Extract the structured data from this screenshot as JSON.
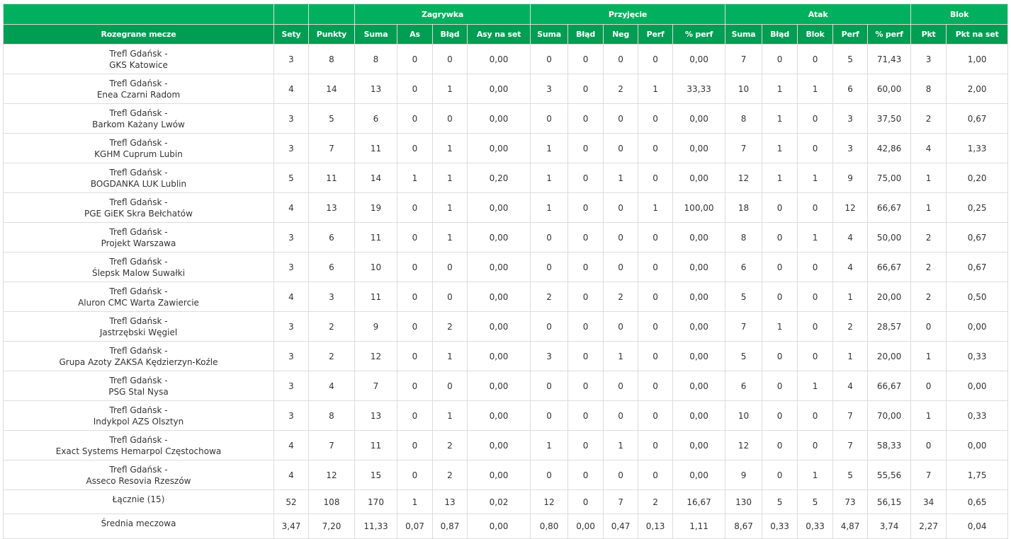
{
  "group_headers": [
    "Zagrywka",
    "Przyjęcie",
    "Atak",
    "Blok"
  ],
  "columns": [
    "Rozegrane mecze",
    "Sety",
    "Punkty",
    "Suma",
    "As",
    "Błąd",
    "Asy na set",
    "Suma",
    "Błąd",
    "Neg",
    "Perf",
    "% perf",
    "Suma",
    "Błąd",
    "Blok",
    "Perf",
    "% perf",
    "Pkt",
    "Pkt na set"
  ],
  "rows": [
    {
      "home": "Trefl Gdańsk -",
      "away": "GKS Katowice",
      "values": [
        "3",
        "8",
        "8",
        "0",
        "0",
        "0,00",
        "0",
        "0",
        "0",
        "0",
        "0,00",
        "7",
        "0",
        "0",
        "5",
        "71,43",
        "3",
        "1,00"
      ]
    },
    {
      "home": "Trefl Gdańsk -",
      "away": "Enea Czarni Radom",
      "values": [
        "4",
        "14",
        "13",
        "0",
        "1",
        "0,00",
        "3",
        "0",
        "2",
        "1",
        "33,33",
        "10",
        "1",
        "1",
        "6",
        "60,00",
        "8",
        "2,00"
      ]
    },
    {
      "home": "Trefl Gdańsk -",
      "away": "Barkom Każany Lwów",
      "values": [
        "3",
        "5",
        "6",
        "0",
        "0",
        "0,00",
        "0",
        "0",
        "0",
        "0",
        "0,00",
        "8",
        "1",
        "0",
        "3",
        "37,50",
        "2",
        "0,67"
      ]
    },
    {
      "home": "Trefl Gdańsk -",
      "away": "KGHM Cuprum Lubin",
      "values": [
        "3",
        "7",
        "11",
        "0",
        "1",
        "0,00",
        "1",
        "0",
        "0",
        "0",
        "0,00",
        "7",
        "1",
        "0",
        "3",
        "42,86",
        "4",
        "1,33"
      ]
    },
    {
      "home": "Trefl Gdańsk -",
      "away": "BOGDANKA LUK Lublin",
      "values": [
        "5",
        "11",
        "14",
        "1",
        "1",
        "0,20",
        "1",
        "0",
        "1",
        "0",
        "0,00",
        "12",
        "1",
        "1",
        "9",
        "75,00",
        "1",
        "0,20"
      ]
    },
    {
      "home": "Trefl Gdańsk -",
      "away": "PGE GiEK Skra Bełchatów",
      "values": [
        "4",
        "13",
        "19",
        "0",
        "1",
        "0,00",
        "1",
        "0",
        "0",
        "1",
        "100,00",
        "18",
        "0",
        "0",
        "12",
        "66,67",
        "1",
        "0,25"
      ]
    },
    {
      "home": "Trefl Gdańsk -",
      "away": "Projekt Warszawa",
      "values": [
        "3",
        "6",
        "11",
        "0",
        "1",
        "0,00",
        "0",
        "0",
        "0",
        "0",
        "0,00",
        "8",
        "0",
        "1",
        "4",
        "50,00",
        "2",
        "0,67"
      ]
    },
    {
      "home": "Trefl Gdańsk -",
      "away": "Ślepsk Malow Suwałki",
      "values": [
        "3",
        "6",
        "10",
        "0",
        "0",
        "0,00",
        "0",
        "0",
        "0",
        "0",
        "0,00",
        "6",
        "0",
        "0",
        "4",
        "66,67",
        "2",
        "0,67"
      ]
    },
    {
      "home": "Trefl Gdańsk -",
      "away": "Aluron CMC Warta Zawiercie",
      "values": [
        "4",
        "3",
        "11",
        "0",
        "0",
        "0,00",
        "2",
        "0",
        "2",
        "0",
        "0,00",
        "5",
        "0",
        "0",
        "1",
        "20,00",
        "2",
        "0,50"
      ]
    },
    {
      "home": "Trefl Gdańsk -",
      "away": "Jastrzębski Węgiel",
      "values": [
        "3",
        "2",
        "9",
        "0",
        "2",
        "0,00",
        "0",
        "0",
        "0",
        "0",
        "0,00",
        "7",
        "1",
        "0",
        "2",
        "28,57",
        "0",
        "0,00"
      ]
    },
    {
      "home": "Trefl Gdańsk -",
      "away": "Grupa Azoty ZAKSA Kędzierzyn-Koźle",
      "values": [
        "3",
        "2",
        "12",
        "0",
        "1",
        "0,00",
        "3",
        "0",
        "1",
        "0",
        "0,00",
        "5",
        "0",
        "0",
        "1",
        "20,00",
        "1",
        "0,33"
      ]
    },
    {
      "home": "Trefl Gdańsk -",
      "away": "PSG Stal Nysa",
      "values": [
        "3",
        "4",
        "7",
        "0",
        "0",
        "0,00",
        "0",
        "0",
        "0",
        "0",
        "0,00",
        "6",
        "0",
        "1",
        "4",
        "66,67",
        "0",
        "0,00"
      ]
    },
    {
      "home": "Trefl Gdańsk -",
      "away": "Indykpol AZS Olsztyn",
      "values": [
        "3",
        "8",
        "13",
        "0",
        "1",
        "0,00",
        "0",
        "0",
        "0",
        "0",
        "0,00",
        "10",
        "0",
        "0",
        "7",
        "70,00",
        "1",
        "0,33"
      ]
    },
    {
      "home": "Trefl Gdańsk -",
      "away": "Exact Systems Hemarpol Częstochowa",
      "values": [
        "4",
        "7",
        "11",
        "0",
        "2",
        "0,00",
        "1",
        "0",
        "1",
        "0",
        "0,00",
        "12",
        "0",
        "0",
        "7",
        "58,33",
        "0",
        "0,00"
      ]
    },
    {
      "home": "Trefl Gdańsk -",
      "away": "Asseco Resovia Rzeszów",
      "values": [
        "4",
        "12",
        "15",
        "0",
        "2",
        "0,00",
        "0",
        "0",
        "0",
        "0",
        "0,00",
        "9",
        "0",
        "1",
        "5",
        "55,56",
        "7",
        "1,75"
      ]
    }
  ],
  "total": {
    "label": "Łącznie (15)",
    "values": [
      "52",
      "108",
      "170",
      "1",
      "13",
      "0,02",
      "12",
      "0",
      "7",
      "2",
      "16,67",
      "130",
      "5",
      "5",
      "73",
      "56,15",
      "34",
      "0,65"
    ]
  },
  "average": {
    "label": "Średnia meczowa",
    "values": [
      "3,47",
      "7,20",
      "11,33",
      "0,07",
      "0,87",
      "0,00",
      "0,80",
      "0,00",
      "0,47",
      "0,13",
      "1,11",
      "8,67",
      "0,33",
      "0,33",
      "4,87",
      "3,74",
      "2,27",
      "0,04"
    ]
  }
}
